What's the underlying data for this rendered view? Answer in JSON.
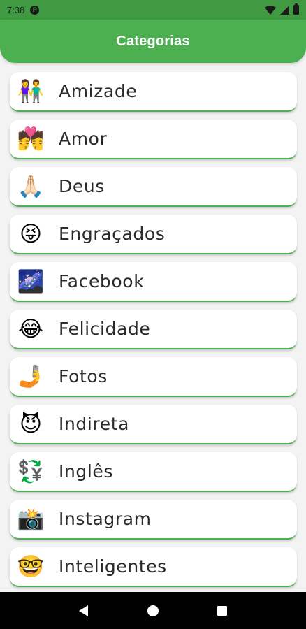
{
  "status_bar": {
    "time": "7:38",
    "app_icon": "P"
  },
  "app_bar": {
    "title": "Categorias",
    "color": "#4caf50"
  },
  "categories": [
    {
      "label": "Amizade",
      "emoji": "👫"
    },
    {
      "label": "Amor",
      "emoji": "💏"
    },
    {
      "label": "Deus",
      "emoji": "🙏🏻"
    },
    {
      "label": "Engraçados",
      "emoji": "😝"
    },
    {
      "label": "Facebook",
      "emoji": "🌌"
    },
    {
      "label": "Felicidade",
      "emoji": "😂"
    },
    {
      "label": "Fotos",
      "emoji": "🤳"
    },
    {
      "label": "Indireta",
      "emoji": "😈"
    },
    {
      "label": "Inglês",
      "emoji": "💱"
    },
    {
      "label": "Instagram",
      "emoji": "📸"
    },
    {
      "label": "Inteligentes",
      "emoji": "🤓"
    }
  ],
  "icons": {
    "status": [
      "wifi-icon",
      "signal-icon",
      "battery-icon"
    ],
    "nav": [
      "back-icon",
      "home-icon",
      "recents-icon"
    ]
  }
}
